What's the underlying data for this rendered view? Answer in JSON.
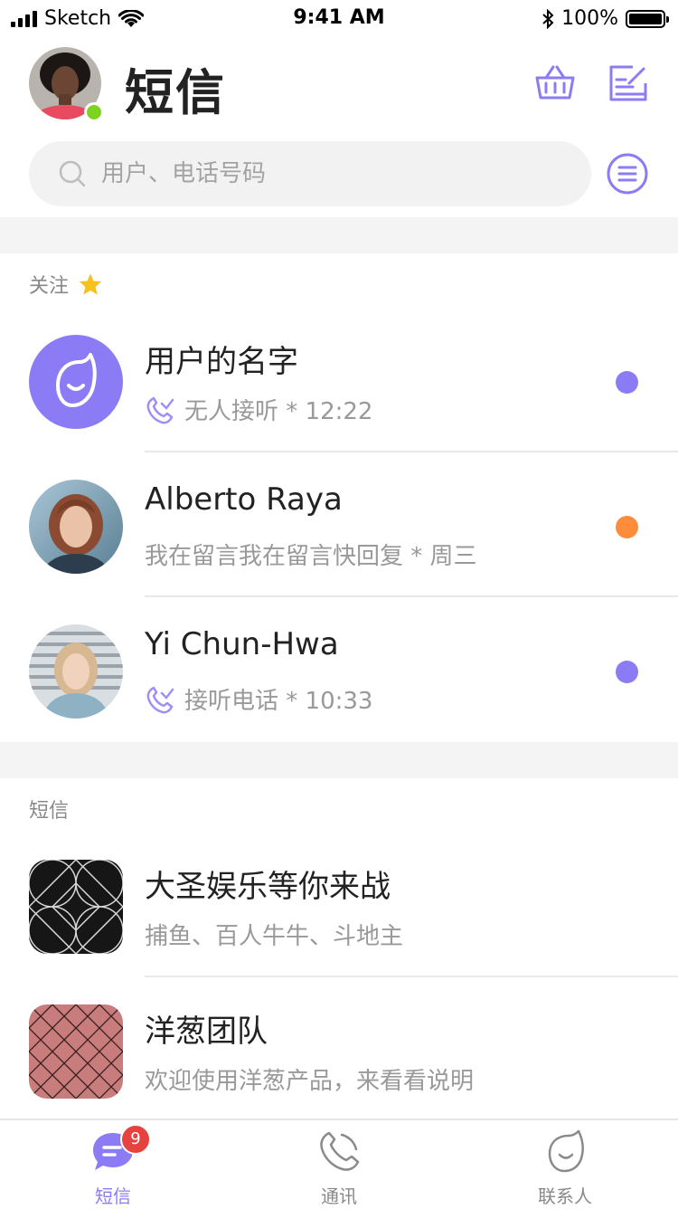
{
  "status_bar": {
    "carrier": "Sketch",
    "time": "9:41 AM",
    "battery": "100%"
  },
  "header": {
    "title": "短信"
  },
  "search": {
    "placeholder": "用户、电话号码"
  },
  "colors": {
    "accent": "#8b7cf6",
    "online": "#7ed321",
    "unread_orange": "#ff8c3a",
    "badge": "#e64340"
  },
  "favorites": {
    "label": "关注",
    "items": [
      {
        "name": "用户的名字",
        "status_icon": "call-missed-icon",
        "subtitle": "无人接听 * 12:22",
        "dot_color": "#8b7cf6"
      },
      {
        "name": "Alberto Raya",
        "subtitle": "我在留言我在留言快回复 * 周三",
        "dot_color": "#ff8c3a"
      },
      {
        "name": "Yi Chun-Hwa",
        "status_icon": "call-answered-icon",
        "subtitle": "接听电话 * 10:33",
        "dot_color": "#8b7cf6"
      }
    ]
  },
  "messages": {
    "label": "短信",
    "items": [
      {
        "name": "大圣娱乐等你来战",
        "subtitle": "捕鱼、百人牛牛、斗地主"
      },
      {
        "name": "洋葱团队",
        "subtitle": "欢迎使用洋葱产品，来看看说明"
      }
    ]
  },
  "tabbar": {
    "tabs": [
      {
        "label": "短信",
        "icon": "message-icon",
        "badge": "9",
        "active": true
      },
      {
        "label": "通讯",
        "icon": "phone-icon"
      },
      {
        "label": "联系人",
        "icon": "contact-icon"
      }
    ]
  }
}
